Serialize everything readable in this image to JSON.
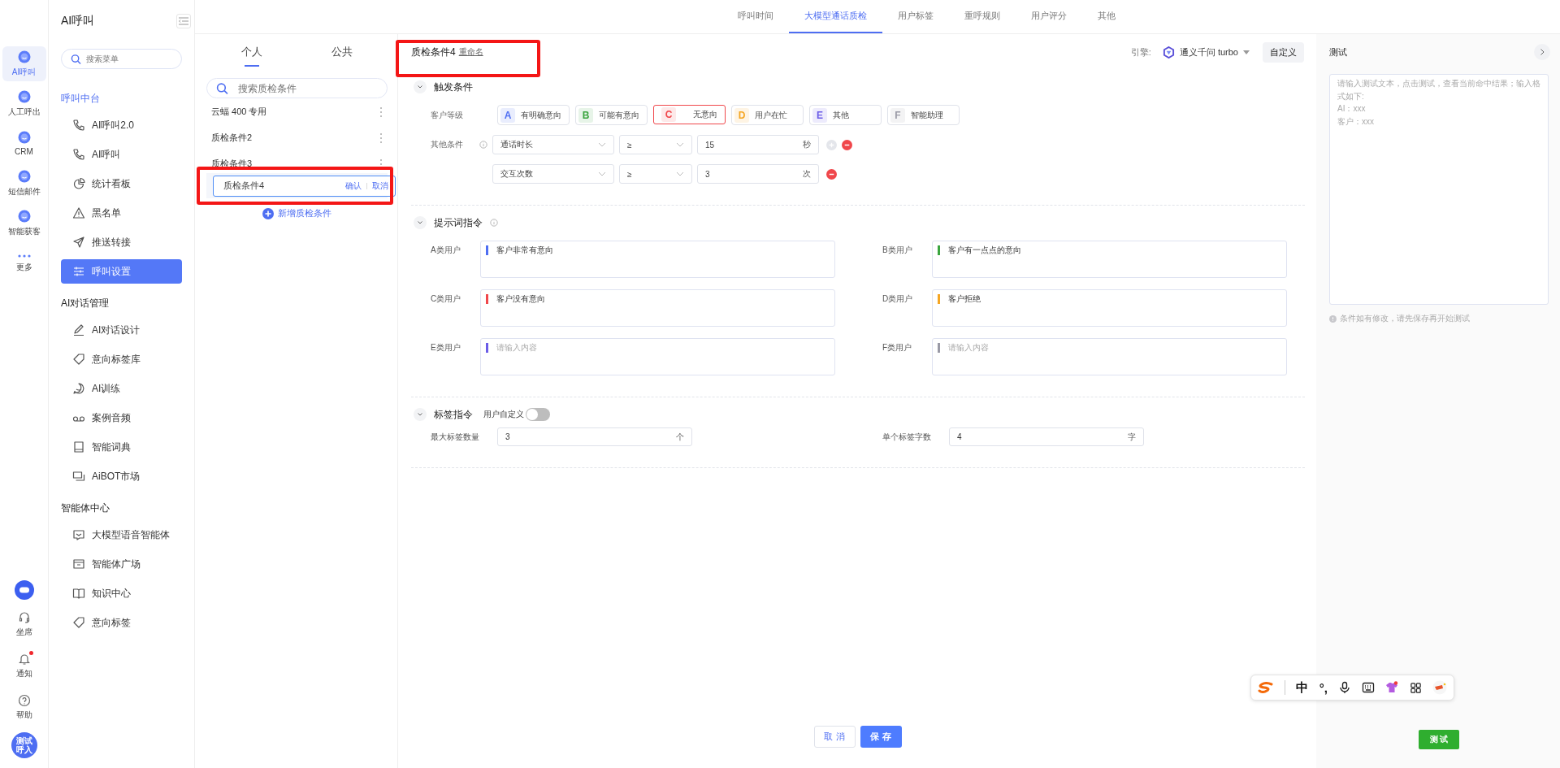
{
  "rail": {
    "items": [
      {
        "label": "AI呼叫",
        "selected": true
      },
      {
        "label": "人工呼出",
        "selected": false
      },
      {
        "label": "CRM",
        "selected": false
      },
      {
        "label": "短信邮件",
        "selected": false
      },
      {
        "label": "智能获客",
        "selected": false
      },
      {
        "label": "更多",
        "selected": false
      }
    ],
    "bottom": [
      {
        "label": "坐席",
        "badge": false
      },
      {
        "label": "通知",
        "badge": true
      },
      {
        "label": "帮助",
        "badge": false
      }
    ],
    "avatar": [
      "测试",
      "呼入"
    ]
  },
  "sidebar": {
    "title": "AI呼叫",
    "search": {
      "placeholder": "搜索菜单"
    },
    "groups": [
      {
        "title": "呼叫中台",
        "items": [
          {
            "label": "AI呼叫2.0",
            "selected": false
          },
          {
            "label": "AI呼叫",
            "selected": false
          },
          {
            "label": "统计看板",
            "selected": false
          },
          {
            "label": "黑名单",
            "selected": false
          },
          {
            "label": "推送转接",
            "selected": false
          },
          {
            "label": "呼叫设置",
            "selected": true
          }
        ]
      },
      {
        "title": "AI对话管理",
        "items": [
          {
            "label": "AI对话设计",
            "selected": false
          },
          {
            "label": "意向标签库",
            "selected": false
          },
          {
            "label": "AI训练",
            "selected": false
          },
          {
            "label": "案例音频",
            "selected": false
          },
          {
            "label": "智能词典",
            "selected": false
          },
          {
            "label": "AiBOT市场",
            "selected": false
          }
        ]
      },
      {
        "title": "智能体中心",
        "items": [
          {
            "label": "大模型语音智能体",
            "selected": false
          },
          {
            "label": "智能体广场",
            "selected": false
          },
          {
            "label": "知识中心",
            "selected": false
          },
          {
            "label": "意向标签",
            "selected": false
          }
        ]
      }
    ]
  },
  "top_tabs": [
    {
      "label": "呼叫时间",
      "selected": false
    },
    {
      "label": "大模型通话质检",
      "selected": true
    },
    {
      "label": "用户标签",
      "selected": false
    },
    {
      "label": "重呼规则",
      "selected": false
    },
    {
      "label": "用户评分",
      "selected": false
    },
    {
      "label": "其他",
      "selected": false
    }
  ],
  "conditions": {
    "tabs": [
      {
        "label": "个人",
        "selected": true
      },
      {
        "label": "公共",
        "selected": false
      }
    ],
    "search": {
      "placeholder": "搜索质检条件"
    },
    "items": [
      {
        "kind": "item",
        "label": "云蝠 400 专用"
      },
      {
        "kind": "item",
        "label": "质检条件2"
      },
      {
        "kind": "item",
        "label": "质检条件3"
      },
      {
        "kind": "editing",
        "value": "质检条件4",
        "confirm": "确认",
        "cancel": "取消",
        "highlighted": true
      }
    ],
    "add_button": "新增质检条件"
  },
  "editor": {
    "title": "质检条件4",
    "rename_link": "重命名",
    "highlighted": true,
    "engine": {
      "label": "引擎:",
      "model": "通义千问 turbo"
    },
    "customize_button": "自定义",
    "trigger": {
      "title": "触发条件",
      "expanded": true,
      "level_label": "客户等级",
      "levels": [
        {
          "letter": "A",
          "label": "有明确意向",
          "color": "#4e6ef2",
          "selected": false
        },
        {
          "letter": "B",
          "label": "可能有意向",
          "color": "#3ba53f",
          "selected": false
        },
        {
          "letter": "C",
          "label": "无意向",
          "color": "#f0474b",
          "selected": true
        },
        {
          "letter": "D",
          "label": "用户在忙",
          "color": "#f5a623",
          "selected": false
        },
        {
          "letter": "E",
          "label": "其他",
          "color": "#6b5ce7",
          "selected": false
        },
        {
          "letter": "F",
          "label": "智能助理",
          "color": "#9a9aa6",
          "selected": false
        }
      ],
      "other_label": "其他条件",
      "rules": [
        {
          "field": "通话时长",
          "operator": "≥",
          "value": "15",
          "unit": "秒",
          "can_add": true
        },
        {
          "field": "交互次数",
          "operator": "≥",
          "value": "3",
          "unit": "次",
          "can_add": false
        }
      ]
    },
    "prompts": {
      "title": "提示词指令",
      "expanded": true,
      "items": [
        {
          "label": "A类用户",
          "color": "#4e6ef2",
          "value": "客户非常有意向"
        },
        {
          "label": "B类用户",
          "color": "#3ba53f",
          "value": "客户有一点点的意向"
        },
        {
          "label": "C类用户",
          "color": "#f0474b",
          "value": "客户没有意向"
        },
        {
          "label": "D类用户",
          "color": "#f5a623",
          "value": "客户拒绝"
        },
        {
          "label": "E类用户",
          "color": "#6b5ce7",
          "placeholder": "请输入内容"
        },
        {
          "label": "F类用户",
          "color": "#9a9aa6",
          "placeholder": "请输入内容"
        }
      ]
    },
    "tags": {
      "title": "标签指令",
      "expanded": true,
      "switch_label": "用户自定义",
      "custom": false,
      "fields": [
        {
          "label": "最大标签数量",
          "value": "3",
          "unit": "个"
        },
        {
          "label": "单个标签字数",
          "value": "4",
          "unit": "字"
        }
      ]
    },
    "actions": {
      "cancel": "取 消",
      "save": "保 存"
    }
  },
  "test_panel": {
    "title": "测试",
    "placeholder": "请输入测试文本，点击测试，查看当前命中结果；输入格式如下:\nAI：xxx\n客户：xxx",
    "note": "条件如有修改，请先保存再开始测试",
    "button": "测 试"
  },
  "ime_toolbar": {
    "mode": "中",
    "punctuation": "°,"
  }
}
